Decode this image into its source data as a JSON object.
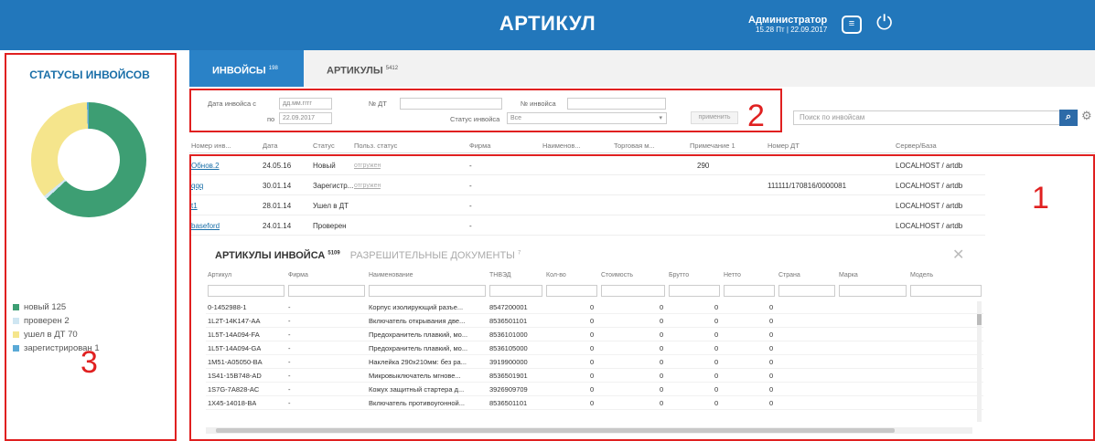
{
  "header": {
    "title": "АРТИКУЛ",
    "user": "Администратор",
    "datetime": "15.28 Пт | 22.09.2017"
  },
  "sidebar": {
    "title": "СТАТУСЫ ИНВОЙСОВ",
    "chart_data": {
      "type": "pie",
      "categories": [
        "новый",
        "проверен",
        "ушел в ДТ",
        "зарегистрирован"
      ],
      "values": [
        125,
        2,
        70,
        1
      ],
      "colors": [
        "#3d9e73",
        "#cfe6f2",
        "#f5e58c",
        "#5aa9d6"
      ]
    },
    "legend": [
      "новый 125",
      "проверен 2",
      "ушел в ДТ 70",
      "зарегистрирован 1"
    ]
  },
  "tabs": [
    {
      "label": "ИНВОЙСЫ",
      "count": "198"
    },
    {
      "label": "АРТИКУЛЫ",
      "count": "5412"
    }
  ],
  "filter": {
    "date_label": "Дата инвойса с",
    "date_from": "дд.мм.гггг",
    "to_label": "по",
    "date_to": "22.09.2017",
    "dt_label": "№ ДТ",
    "invoice_no_label": "№ инвойса",
    "status_label": "Статус инвойса",
    "status_value": "Все",
    "apply": "применить"
  },
  "search": {
    "placeholder": "Поиск по инвойсам"
  },
  "invoices": {
    "columns": [
      "Номер инв...",
      "Дата",
      "Статус",
      "Польз. статус",
      "Фирма",
      "Наименов...",
      "Торговая м...",
      "Примечание 1",
      "Номер ДТ",
      "Сервер/База"
    ],
    "rows": [
      {
        "no": "Обнов.2",
        "date": "24.05.16",
        "status": "Новый",
        "ustatus": "отгружен",
        "firm": "-",
        "note": "290",
        "dt": "",
        "server": "LOCALHOST / artdb"
      },
      {
        "no": "qqq",
        "date": "30.01.14",
        "status": "Зарегистр...",
        "ustatus": "отгружен",
        "firm": "-",
        "note": "",
        "dt": "111111/170816/0000081",
        "server": "LOCALHOST / artdb"
      },
      {
        "no": "t1",
        "date": "28.01.14",
        "status": "Ушел в ДТ",
        "ustatus": "",
        "firm": "-",
        "note": "",
        "dt": "",
        "server": "LOCALHOST / artdb"
      },
      {
        "no": "baseford",
        "date": "24.01.14",
        "status": "Проверен",
        "ustatus": "",
        "firm": "-",
        "note": "",
        "dt": "",
        "server": "LOCALHOST / artdb"
      }
    ]
  },
  "articles": {
    "tab1": "АРТИКУЛЫ ИНВОЙСА",
    "tab1_count": "5109",
    "tab2": "РАЗРЕШИТЕЛЬНЫЕ ДОКУМЕНТЫ",
    "tab2_count": "7",
    "columns": [
      "Артикул",
      "Фирма",
      "Наименование",
      "ТНВЭД",
      "Кол-во",
      "Стоимость",
      "Брутто",
      "Нетто",
      "Страна",
      "Марка",
      "Модель"
    ],
    "rows": [
      {
        "art": "0-1452988-1",
        "firm": "-",
        "name": "Корпус изолирующий разъе...",
        "code": "8547200001",
        "qty": "0",
        "cost": "0",
        "gross": "0",
        "net": "0"
      },
      {
        "art": "1L2T-14K147-AA",
        "firm": "-",
        "name": "Включатель открывания две...",
        "code": "8536501101",
        "qty": "0",
        "cost": "0",
        "gross": "0",
        "net": "0"
      },
      {
        "art": "1L5T-14A094-FA",
        "firm": "-",
        "name": "Предохранитель плавкий, мо...",
        "code": "8536101000",
        "qty": "0",
        "cost": "0",
        "gross": "0",
        "net": "0"
      },
      {
        "art": "1L5T-14A094-GA",
        "firm": "-",
        "name": "Предохранитель плавкий, мо...",
        "code": "8536105000",
        "qty": "0",
        "cost": "0",
        "gross": "0",
        "net": "0"
      },
      {
        "art": "1M51-A05050-BA",
        "firm": "-",
        "name": "Наклейка 290х210мм: без ра...",
        "code": "3919900000",
        "qty": "0",
        "cost": "0",
        "gross": "0",
        "net": "0"
      },
      {
        "art": "1S41-15B748-AD",
        "firm": "-",
        "name": "Микровыключатель мгнове...",
        "code": "8536501901",
        "qty": "0",
        "cost": "0",
        "gross": "0",
        "net": "0"
      },
      {
        "art": "1S7G-7A828-AC",
        "firm": "-",
        "name": "Кожух защитный стартера д...",
        "code": "3926909709",
        "qty": "0",
        "cost": "0",
        "gross": "0",
        "net": "0"
      },
      {
        "art": "1X45-14018-BA",
        "firm": "-",
        "name": "Включатель противоугонной...",
        "code": "8536501101",
        "qty": "0",
        "cost": "0",
        "gross": "0",
        "net": "0"
      }
    ]
  },
  "annotations": [
    "1",
    "2",
    "3"
  ]
}
